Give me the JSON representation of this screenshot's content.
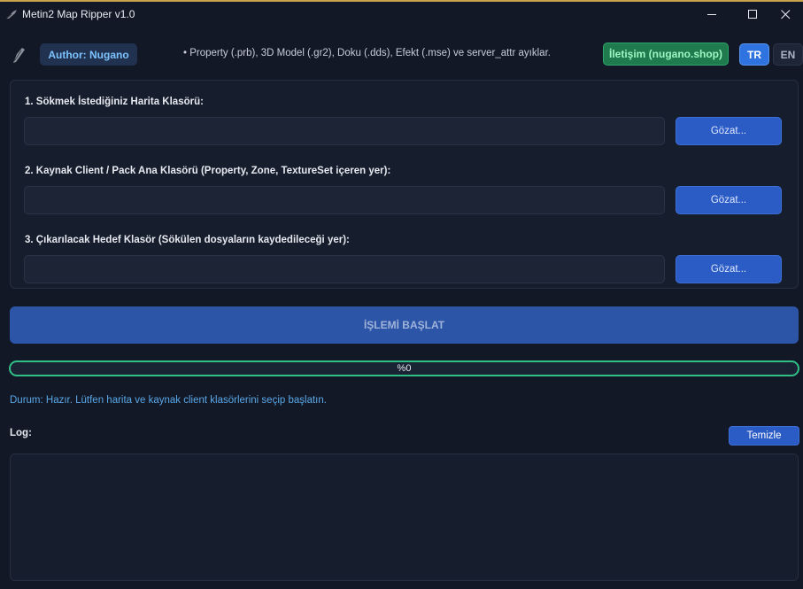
{
  "window": {
    "title": "Metin2 Map Ripper v1.0"
  },
  "header": {
    "author_label": "Author: Nugano",
    "features_text": "• Property (.prb), 3D Model (.gr2), Doku (.dds), Efekt (.mse) ve server_attr ayıklar.",
    "contact_label": "İletişim (nugano.shop)",
    "lang_tr": "TR",
    "lang_en": "EN",
    "active_language": "TR"
  },
  "folders": [
    {
      "label": "1. Sökmek İstediğiniz Harita Klasörü:",
      "value": "",
      "browse_label": "Gözat..."
    },
    {
      "label": "2. Kaynak Client / Pack Ana Klasörü (Property, Zone, TextureSet içeren yer):",
      "value": "",
      "browse_label": "Gözat..."
    },
    {
      "label": "3. Çıkarılacak Hedef Klasör (Sökülen dosyaların kaydedileceği yer):",
      "value": "",
      "browse_label": "Gözat..."
    }
  ],
  "start_label": "İŞLEMİ BAŞLAT",
  "progress": {
    "value": 0,
    "text": "%0"
  },
  "status_text": "Durum: Hazır. Lütfen harita ve kaynak client klasörlerini seçip başlatın.",
  "log": {
    "label": "Log:",
    "clear_label": "Temizle",
    "content": ""
  },
  "icons": {
    "app": "feather-icon",
    "logo": "feather-icon",
    "minimize": "minimize-icon",
    "maximize": "maximize-icon",
    "close": "close-icon"
  },
  "colors": {
    "background": "#121826",
    "accent_blue": "#2b5bc4",
    "accent_green": "#2fbf87",
    "status_blue": "#5aa8e8"
  }
}
